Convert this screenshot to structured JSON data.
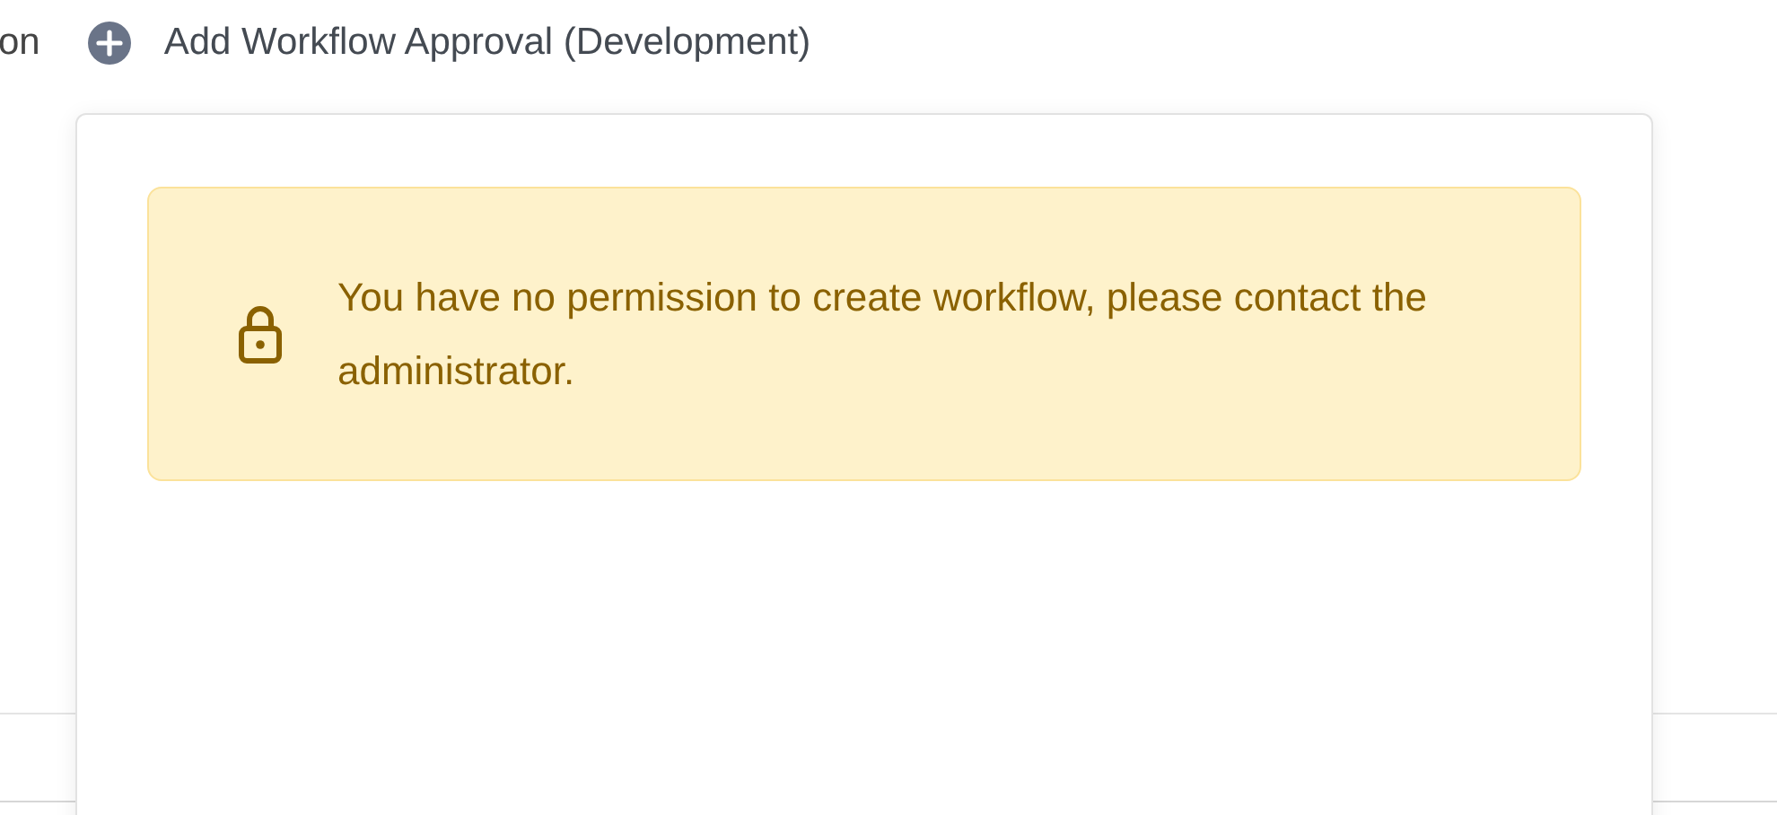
{
  "header": {
    "partial_label": "on",
    "title": "Add Workflow Approval (Development)"
  },
  "alert": {
    "message": "You have no permission to create workflow, please contact the administrator."
  }
}
